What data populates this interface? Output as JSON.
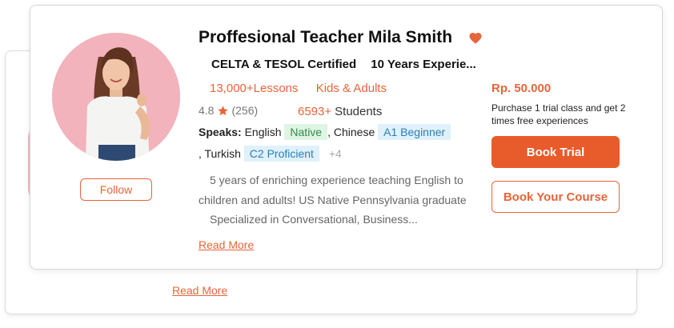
{
  "colors": {
    "accent": "#e8643a",
    "button_fill": "#e85b2a",
    "avatar_bg": "#f2b3bd",
    "native_tag_bg": "#dff5e3",
    "level_tag_bg": "#dff1fb"
  },
  "back_card": {
    "read_more": "Read More"
  },
  "teacher": {
    "name": "Proffesional Teacher Mila Smith",
    "favorite_icon": "heart-icon",
    "certification": "CELTA & TESOL Certified",
    "experience": "10 Years Experie...",
    "lessons": "13,000+Lessons",
    "audience": "Kids & Adults",
    "rating": "4.8",
    "rating_icon": "star-icon",
    "review_count": "(256)",
    "students_count": "6593+",
    "students_label": "Students",
    "speaks_label": "Speaks:",
    "languages": [
      {
        "name": "English",
        "level": "Native"
      },
      {
        "name": ", Chinese",
        "level": "A1 Beginner"
      },
      {
        "name": ", Turkish",
        "level": "C2 Proficient"
      }
    ],
    "more_languages": "+4",
    "bio": [
      "5 years of enriching experience teaching English to",
      "children and adults!   US Native Pennsylvania graduate",
      "Specialized in Conversational, Business..."
    ],
    "read_more": "Read More",
    "follow_label": "Follow"
  },
  "pricing": {
    "price": "Rp. 50.000",
    "promo": "Purchase 1 trial class and get 2 times free experiences",
    "book_trial_label": "Book Trial",
    "book_course_label": "Book Your Course"
  }
}
